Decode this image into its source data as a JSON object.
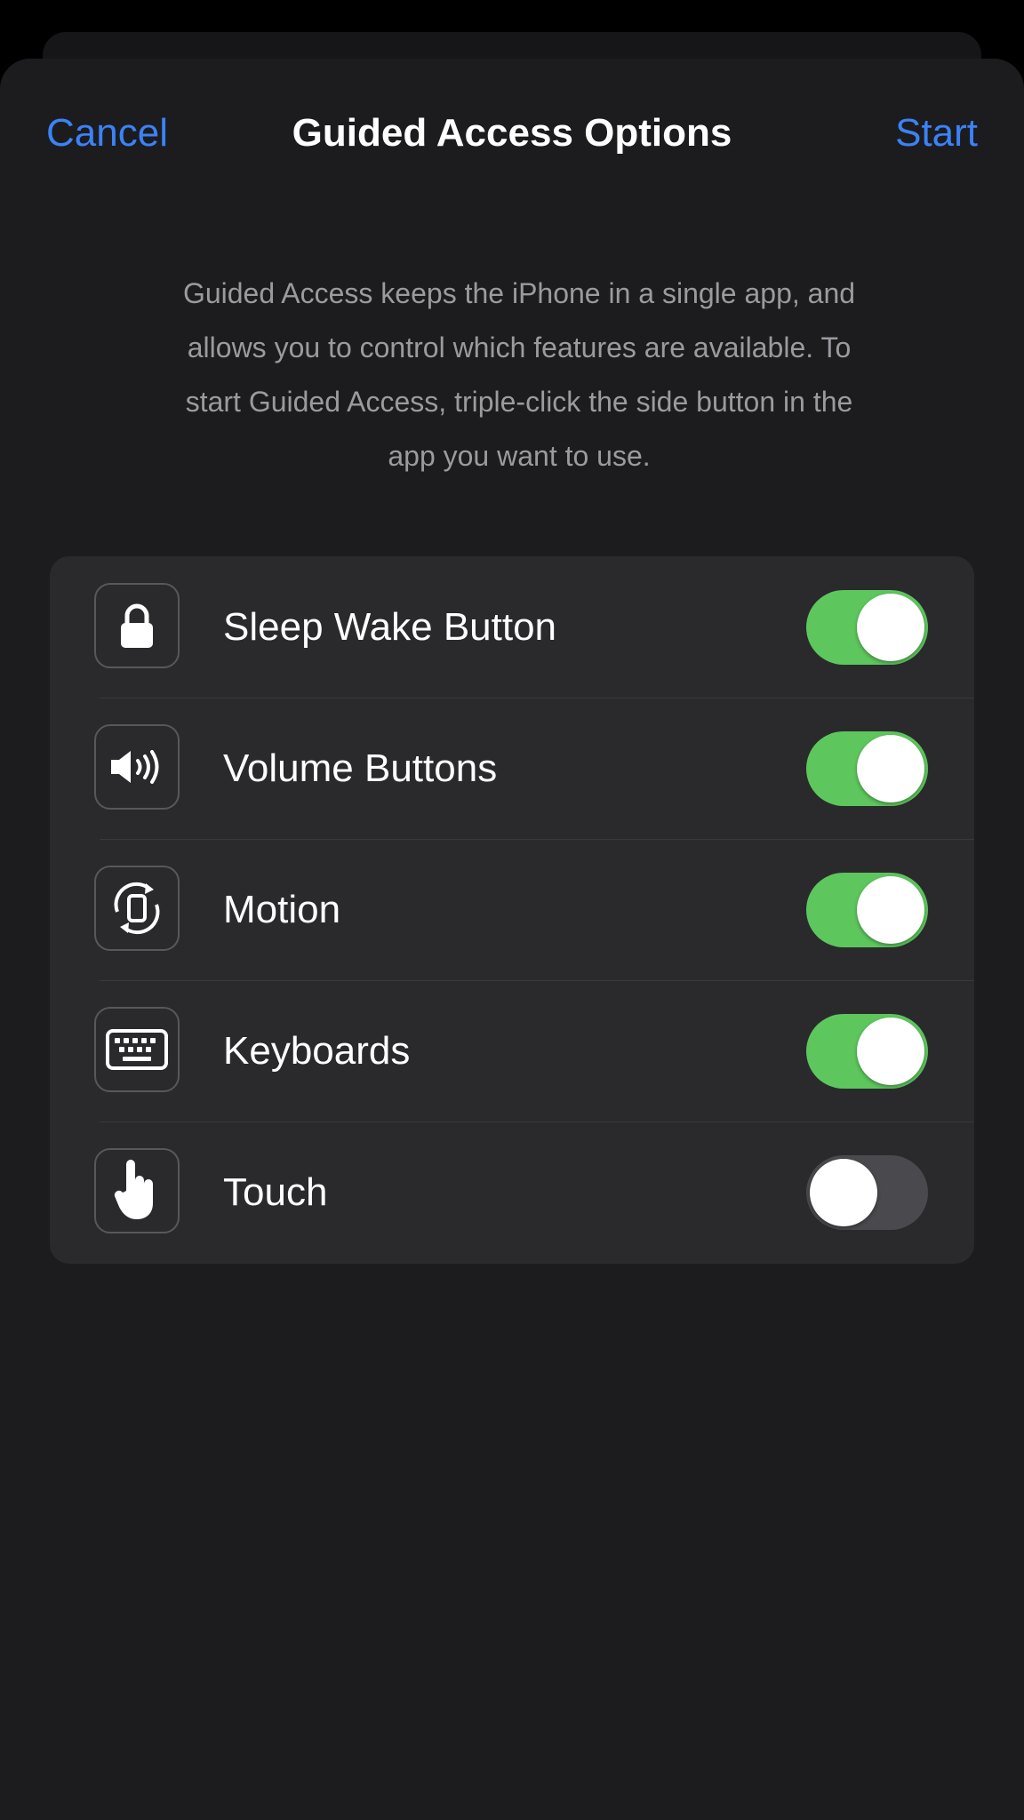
{
  "nav": {
    "cancel_label": "Cancel",
    "title": "Guided Access Options",
    "start_label": "Start"
  },
  "description": "Guided Access keeps the iPhone in a single app, and allows you to control which features are available. To start Guided Access, triple-click the side button in the app you want to use.",
  "options": [
    {
      "label": "Sleep Wake Button",
      "icon": "lock-icon",
      "enabled": true
    },
    {
      "label": "Volume Buttons",
      "icon": "speaker-icon",
      "enabled": true
    },
    {
      "label": "Motion",
      "icon": "rotation-icon",
      "enabled": true
    },
    {
      "label": "Keyboards",
      "icon": "keyboard-icon",
      "enabled": true
    },
    {
      "label": "Touch",
      "icon": "hand-pointer-icon",
      "enabled": false
    }
  ],
  "colors": {
    "accent": "#3b82f6",
    "toggle_on": "#5dc75d",
    "toggle_off": "#4a4a4e",
    "sheet_background": "#1c1c1e",
    "group_background": "#2a2a2c"
  }
}
